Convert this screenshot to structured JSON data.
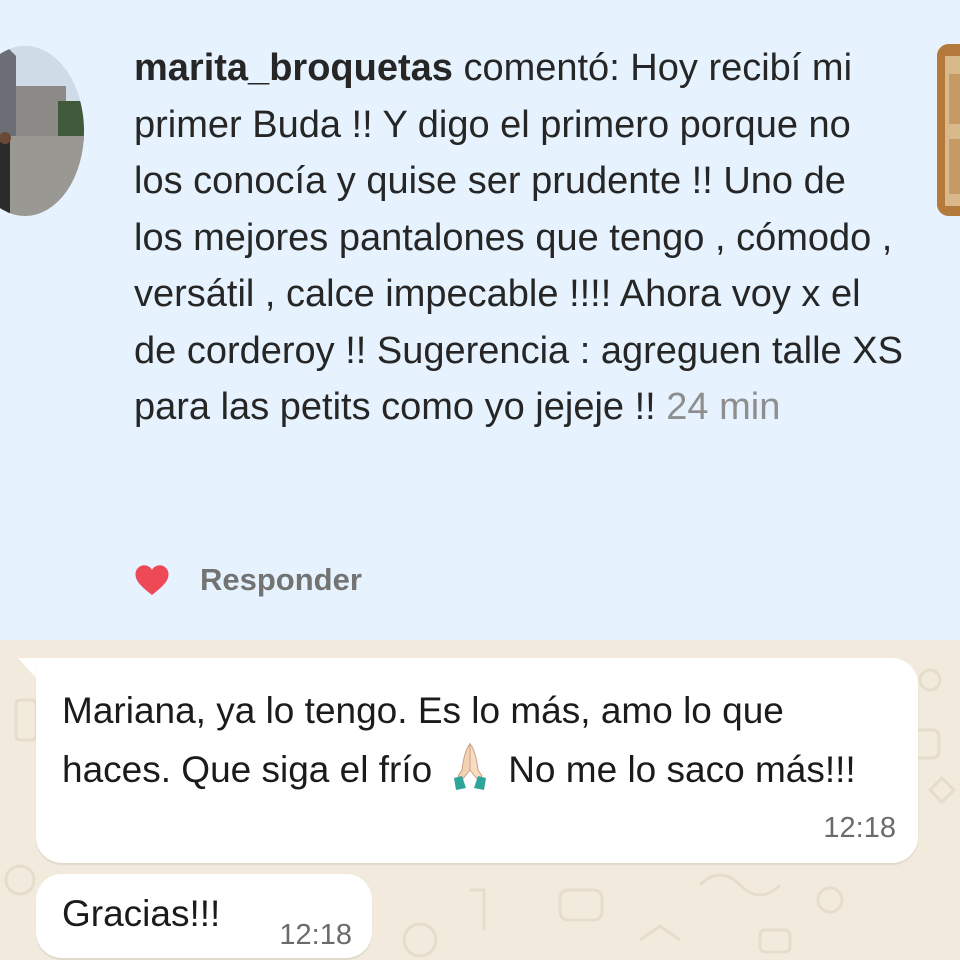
{
  "instagram_comment": {
    "username": "marita_broquetas",
    "body": " comentó: Hoy recibí mi primer Buda !! Y digo el primero porque no los conocía y quise ser prudente !! Uno de los mejores pantalones que tengo , cómodo , versátil , calce impecable !!!! Ahora voy x el de corderoy !! Sugerencia : agreguen talle XS para las petits como yo jejeje !! ",
    "time": "24 min",
    "like_icon": "heart-icon",
    "like_color": "#ed4956",
    "reply_label": "Responder"
  },
  "chat": {
    "messages": [
      {
        "text_before_emoji": "Mariana, ya lo tengo. Es lo más, amo lo que haces. Que siga el frío",
        "emoji": "folded-hands-icon",
        "text_after_emoji": "No me lo saco más!!!",
        "time": "12:18"
      },
      {
        "text": "Gracias!!!",
        "time": "12:18"
      }
    ]
  },
  "colors": {
    "instagram_background": "#e6f2fd",
    "chat_background": "#f2ebdd",
    "bubble_background": "#ffffff"
  }
}
